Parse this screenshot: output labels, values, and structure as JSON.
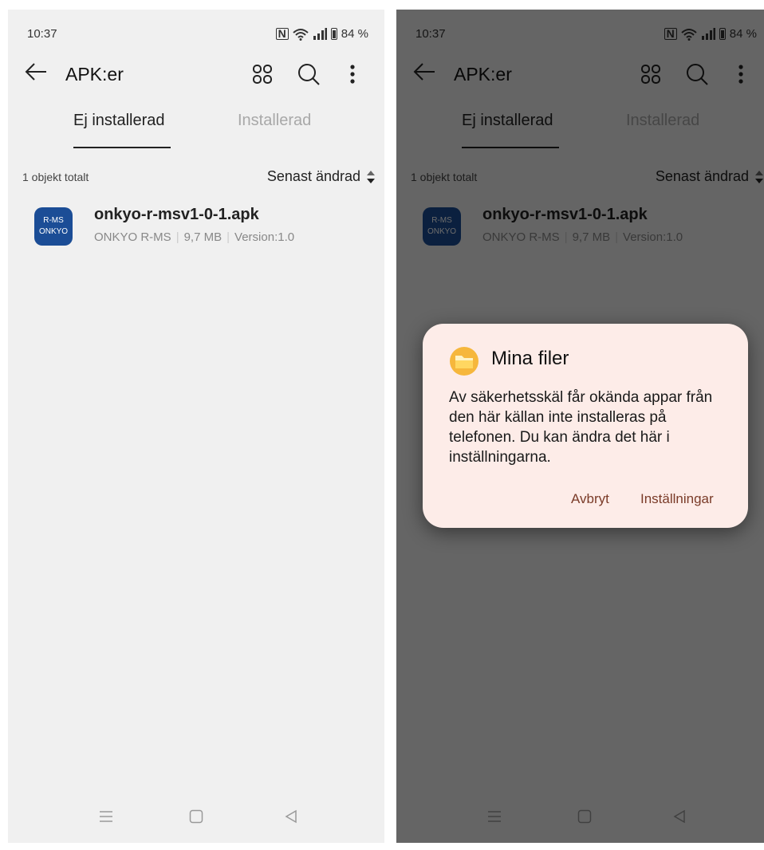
{
  "status": {
    "time": "10:37",
    "nfc": "N",
    "battery": "84 %"
  },
  "header": {
    "title": "APK:er"
  },
  "tabs": [
    {
      "label": "Ej installerad"
    },
    {
      "label": "Installerad"
    }
  ],
  "list": {
    "summary": "1 objekt totalt",
    "sort_label": "Senast ändrad"
  },
  "file": {
    "icon_line1": "R-MS",
    "icon_line2": "ONKYO",
    "name": "onkyo-r-msv1-0-1.apk",
    "app": "ONKYO R-MS",
    "size": "9,7 MB",
    "version": "Version:1.0"
  },
  "dialog": {
    "title": "Mina filer",
    "message": "Av säkerhetsskäl får okända appar från den här källan inte installeras på telefonen. Du kan ändra det här i inställningarna.",
    "cancel": "Avbryt",
    "settings": "Inställningar"
  },
  "colors": {
    "background": "#f0f0f0",
    "accent": "#7a3b28",
    "dialog_bg": "#fdece8",
    "app_icon": "#1b4d96"
  }
}
